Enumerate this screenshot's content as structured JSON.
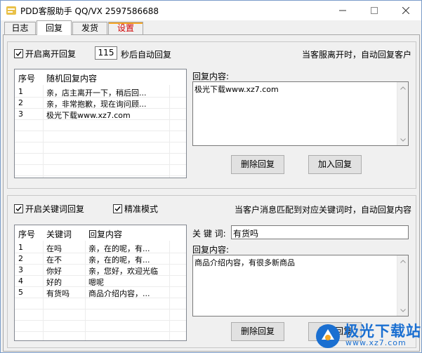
{
  "window": {
    "title": "PDD客服助手 QQ/VX 2597586688",
    "controls": [
      "minimize-icon",
      "maximize-icon",
      "close-icon"
    ]
  },
  "tabs": [
    {
      "label": "日志",
      "active": false
    },
    {
      "label": "回复",
      "active": true
    },
    {
      "label": "发货",
      "active": false
    },
    {
      "label": "设置",
      "active": false
    }
  ],
  "away": {
    "enable_label": "开启离开回复",
    "enabled": true,
    "seconds_value": "115",
    "seconds_suffix": "秒后自动回复",
    "hint": "当客服离开时，自动回复客户",
    "columns": [
      "序号",
      "随机回复内容"
    ],
    "rows": [
      {
        "no": "1",
        "content": "亲，店主离开一下，稍后回..."
      },
      {
        "no": "2",
        "content": "亲，非常抱歉，现在询问顾..."
      },
      {
        "no": "3",
        "content": "极光下载www.xz7.com"
      }
    ],
    "content_label": "回复内容:",
    "content_value": "极光下载www.xz7.com",
    "delete_label": "删除回复",
    "add_label": "加入回复"
  },
  "keyword": {
    "enable_label": "开启关键词回复",
    "enabled": true,
    "exact_label": "精准模式",
    "exact_enabled": true,
    "hint": "当客户消息匹配到对应关键词时，自动回复内容",
    "columns": [
      "序号",
      "关键词",
      "回复内容"
    ],
    "rows": [
      {
        "no": "1",
        "keyword": "在吗",
        "content": "亲，在的呢，有..."
      },
      {
        "no": "2",
        "keyword": "在不",
        "content": "亲，在的呢，有..."
      },
      {
        "no": "3",
        "keyword": "你好",
        "content": "亲，您好，欢迎光临"
      },
      {
        "no": "4",
        "keyword": "好的",
        "content": "嗯呢"
      },
      {
        "no": "5",
        "keyword": "有货吗",
        "content": "商品介绍内容，..."
      }
    ],
    "keyword_label": "关 键 词:",
    "keyword_value": "有货吗",
    "content_label": "回复内容:",
    "content_value": "商品介绍内容，有很多新商品",
    "delete_label": "删除回复",
    "add_label": "加入回复"
  },
  "watermark": {
    "text": "极光下载站",
    "url": "www.xz7.com"
  },
  "colors": {
    "accent": "#1a6fd1",
    "settings_tab_text": "#d00000",
    "settings_tab_marker": "#f5a623"
  }
}
